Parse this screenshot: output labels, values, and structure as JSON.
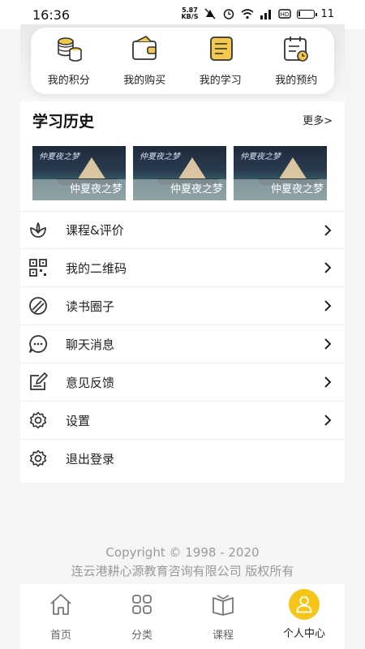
{
  "status": {
    "time": "16:36",
    "net_speed": "5.87",
    "net_unit": "KB/S",
    "battery": "11"
  },
  "quick": [
    {
      "label": "我的积分",
      "icon": "coins-icon"
    },
    {
      "label": "我的购买",
      "icon": "wallet-icon"
    },
    {
      "label": "我的学习",
      "icon": "notes-icon"
    },
    {
      "label": "我的预约",
      "icon": "calendar-icon"
    }
  ],
  "history": {
    "title": "学习历史",
    "more": "更多>",
    "items": [
      {
        "caption": "仲夏夜之梦",
        "logo": "仲夏夜之梦"
      },
      {
        "caption": "仲夏夜之梦",
        "logo": "仲夏夜之梦"
      },
      {
        "caption": "仲夏夜之梦",
        "logo": "仲夏夜之梦"
      }
    ]
  },
  "menu": [
    {
      "label": "课程&评价",
      "icon": "lotus-icon"
    },
    {
      "label": "我的二维码",
      "icon": "qrcode-icon"
    },
    {
      "label": "读书圈子",
      "icon": "aperture-icon"
    },
    {
      "label": "聊天消息",
      "icon": "chat-icon"
    },
    {
      "label": "意见反馈",
      "icon": "feedback-icon"
    },
    {
      "label": "设置",
      "icon": "gear-icon"
    },
    {
      "label": "退出登录",
      "icon": "gear-icon"
    }
  ],
  "copyright": {
    "line1": "Copyright © 1998 - 2020",
    "line2": "连云港耕心源教育咨询有限公司 版权所有"
  },
  "tabs": [
    {
      "label": "首页",
      "icon": "home-icon"
    },
    {
      "label": "分类",
      "icon": "grid-icon"
    },
    {
      "label": "课程",
      "icon": "book-icon"
    },
    {
      "label": "个人中心",
      "icon": "user-icon"
    }
  ],
  "colors": {
    "accent": "#f5c518",
    "icon_gold": "#e8b32a",
    "icon_dark": "#333333"
  }
}
